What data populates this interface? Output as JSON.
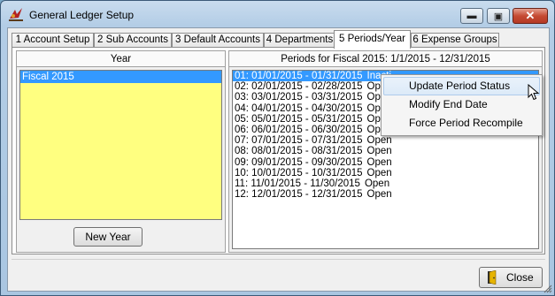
{
  "window": {
    "title": "General Ledger Setup",
    "icon": "ledger-app-icon",
    "controls": {
      "minimize": "▬",
      "maximize": "▣",
      "close": "✕"
    }
  },
  "tabs": [
    {
      "label": "1 Account Setup",
      "active": false
    },
    {
      "label": "2 Sub Accounts",
      "active": false
    },
    {
      "label": "3 Default Accounts",
      "active": false
    },
    {
      "label": "4 Departments",
      "active": false
    },
    {
      "label": "5 Periods/Year",
      "active": true
    },
    {
      "label": "6 Expense Groups",
      "active": false
    }
  ],
  "year_panel": {
    "header": "Year",
    "items": [
      {
        "label": "Fiscal 2015",
        "selected": true
      }
    ],
    "new_year_button": "New Year",
    "list_color": "#ffff80"
  },
  "periods_panel": {
    "header": "Periods for Fiscal 2015: 1/1/2015 - 12/31/2015",
    "periods": [
      {
        "label": "01: 01/01/2015 - 01/31/2015",
        "status": "Inacti",
        "selected": true
      },
      {
        "label": "02: 02/01/2015 - 02/28/2015",
        "status": "Open"
      },
      {
        "label": "03: 03/01/2015 - 03/31/2015",
        "status": "Open"
      },
      {
        "label": "04: 04/01/2015 - 04/30/2015",
        "status": "Open"
      },
      {
        "label": "05: 05/01/2015 - 05/31/2015",
        "status": "Open"
      },
      {
        "label": "06: 06/01/2015 - 06/30/2015",
        "status": "Open"
      },
      {
        "label": "07: 07/01/2015 - 07/31/2015",
        "status": "Open"
      },
      {
        "label": "08: 08/01/2015 - 08/31/2015",
        "status": "Open"
      },
      {
        "label": "09: 09/01/2015 - 09/30/2015",
        "status": "Open"
      },
      {
        "label": "10: 10/01/2015 - 10/31/2015",
        "status": "Open"
      },
      {
        "label": "11: 11/01/2015 - 11/30/2015",
        "status": "Open"
      },
      {
        "label": "12: 12/01/2015 - 12/31/2015",
        "status": "Open"
      }
    ],
    "selection_color": "#3399ff"
  },
  "context_menu": {
    "items": [
      {
        "label": "Update Period Status",
        "hover": true
      },
      {
        "label": "Modify End Date"
      },
      {
        "label": "Force Period Recompile"
      }
    ]
  },
  "footer": {
    "close_button": "Close"
  }
}
